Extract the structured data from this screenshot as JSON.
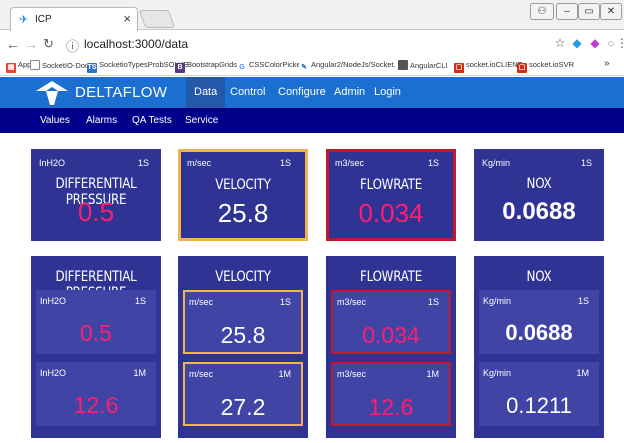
{
  "browser": {
    "tab_title": "ICP",
    "tab_close": "×",
    "url": "localhost:3000/data",
    "bookmarks": [
      {
        "label": "Apps",
        "icon": "apps-icon",
        "color": "#ea4335"
      },
      {
        "label": "SocketIO-Docs",
        "icon": "page-icon",
        "color": "#777777"
      },
      {
        "label": "SocketioTypesProbSOLVE",
        "icon": "ts-icon",
        "color": "#2f74c0"
      },
      {
        "label": "BootstrapGrids",
        "icon": "bootstrap-icon",
        "color": "#563d7c"
      },
      {
        "label": "CSSColorPicker",
        "icon": "google-icon",
        "color": "#4285f4"
      },
      {
        "label": "Angular2/NodeJs/Socket.",
        "icon": "feather-icon",
        "color": "#3b6bd6"
      },
      {
        "label": "AngularCLI",
        "icon": "image-icon",
        "color": "#555555"
      },
      {
        "label": "socket.ioCLIENT",
        "icon": "socket-icon",
        "color": "#d62c1a"
      },
      {
        "label": "socket.ioSVR",
        "icon": "socket-icon",
        "color": "#d62c1a"
      }
    ],
    "more": "»"
  },
  "app": {
    "brand": "DELTAFLOW",
    "nav": [
      "Data",
      "Control",
      "Configure",
      "Admin",
      "Login"
    ],
    "active_nav": "Data",
    "subnav": [
      "Values",
      "Alarms",
      "QA Tests",
      "Service"
    ],
    "colors": {
      "appbar": "#1a6fd0",
      "subbar": "#00008b",
      "panel": "#2f3393",
      "alarm_orange": "#f0b44a",
      "alarm_red": "#c0192e",
      "value_pink": "#ff1e6e"
    }
  },
  "top_cards": [
    {
      "unit": "InH2O",
      "rate": "1S",
      "title": "DIFFERENTIAL PRESSURE",
      "value": "0.5",
      "style": "pink",
      "border": "none"
    },
    {
      "unit": "m/sec",
      "rate": "1S",
      "title": "VELOCITY",
      "value": "25.8",
      "style": "white",
      "border": "orange"
    },
    {
      "unit": "m3/sec",
      "rate": "1S",
      "title": "FLOWRATE",
      "value": "0.034",
      "style": "pink",
      "border": "red"
    },
    {
      "unit": "Kg/min",
      "rate": "1S",
      "title": "NOX",
      "value": "0.0688",
      "style": "white-bold",
      "border": "none"
    }
  ],
  "bottom_cards": [
    {
      "title": "DIFFERENTIAL PRESSURE",
      "rows": [
        {
          "unit": "InH2O",
          "rate": "1S",
          "value": "0.5",
          "style": "pink",
          "border": "none"
        },
        {
          "unit": "InH2O",
          "rate": "1M",
          "value": "12.6",
          "style": "pink",
          "border": "none"
        }
      ]
    },
    {
      "title": "VELOCITY",
      "rows": [
        {
          "unit": "m/sec",
          "rate": "1S",
          "value": "25.8",
          "style": "white",
          "border": "orange"
        },
        {
          "unit": "m/sec",
          "rate": "1M",
          "value": "27.2",
          "style": "white",
          "border": "orange"
        }
      ]
    },
    {
      "title": "FLOWRATE",
      "rows": [
        {
          "unit": "m3/sec",
          "rate": "1S",
          "value": "0.034",
          "style": "pink",
          "border": "red"
        },
        {
          "unit": "m3/sec",
          "rate": "1M",
          "value": "12.6",
          "style": "pink",
          "border": "red"
        }
      ]
    },
    {
      "title": "NOX",
      "rows": [
        {
          "unit": "Kg/min",
          "rate": "1S",
          "value": "0.0688",
          "style": "white-bold",
          "border": "none"
        },
        {
          "unit": "Kg/min",
          "rate": "1M",
          "value": "0.1211",
          "style": "white",
          "border": "none"
        }
      ]
    }
  ]
}
